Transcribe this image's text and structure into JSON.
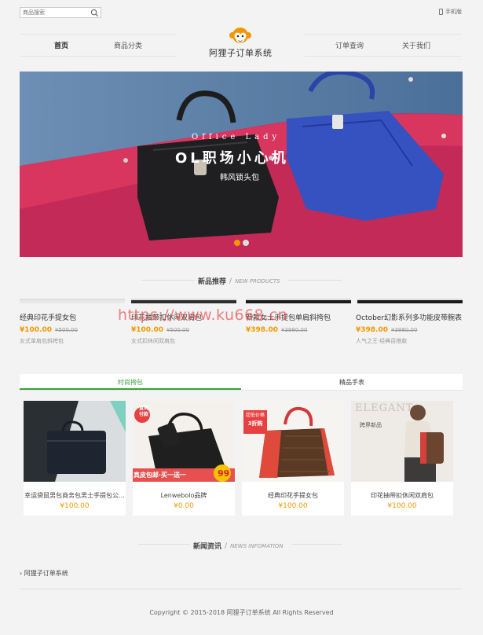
{
  "header": {
    "search_placeholder": "商品搜索",
    "mobile_label": "手机版",
    "logo_text": "阿狸子订单系统",
    "nav": [
      {
        "label": "首页"
      },
      {
        "label": "商品分类"
      },
      {
        "label": "订单查询"
      },
      {
        "label": "关于我们"
      }
    ]
  },
  "banner": {
    "subtitle": "Office Lady",
    "title": "OL职场小心机",
    "caption": "韩风锁头包"
  },
  "new_products": {
    "heading_zh": "新品推荐",
    "heading_slash": "/",
    "heading_en": "NEW PRODUCTS",
    "items": [
      {
        "name": "经典印花手提女包",
        "price": "¥100.00",
        "old_price": "¥500.00",
        "desc": "女式单肩包斜挎包"
      },
      {
        "name": "印花抽带扣休闲双肩包",
        "price": "¥100.00",
        "old_price": "¥500.00",
        "desc": "女式扣休闲双肩包"
      },
      {
        "name": "新款女士手提包单肩斜挎包",
        "price": "¥398.00",
        "old_price": "¥3980.00",
        "desc": ""
      },
      {
        "name": "October幻影系列多功能皮带腕表",
        "price": "¥398.00",
        "old_price": "¥3980.00",
        "desc": "人气之王·经典百搭款"
      }
    ]
  },
  "watermark": "https://www.ku668.cn",
  "tabs": [
    {
      "label": "时尚挎包"
    },
    {
      "label": "精品手表"
    }
  ],
  "products": [
    {
      "name": "幸运袋鼠男包商务包男士手提包公...",
      "price": "¥100.00"
    },
    {
      "name": "Lenwebolo品牌",
      "price": "¥0.00"
    },
    {
      "name": "经典印花手提女包",
      "price": "¥100.00"
    },
    {
      "name": "印花抽带扣休闲双肩包",
      "price": "¥100.00"
    }
  ],
  "promo": {
    "tag1": "直到",
    "tag2": "付款",
    "bottom": "真皮包邮·买一送一",
    "price": "99",
    "badge_top": "超低价格",
    "badge_bottom": "3折购",
    "brand": "ELEGANT",
    "poster": "跨界新品"
  },
  "news": {
    "heading_zh": "新闻资讯",
    "heading_slash": "/",
    "heading_en": "NEWS INFOMATION",
    "item": "阿狸子订单系统"
  },
  "footer": {
    "copyright": "Copyright © 2015-2018 阿狸子订单系统 All Rights Reserved"
  },
  "colors": {
    "accent": "#f39800",
    "tab_active": "#3aa13a",
    "banner_bg": "#c8285a"
  }
}
